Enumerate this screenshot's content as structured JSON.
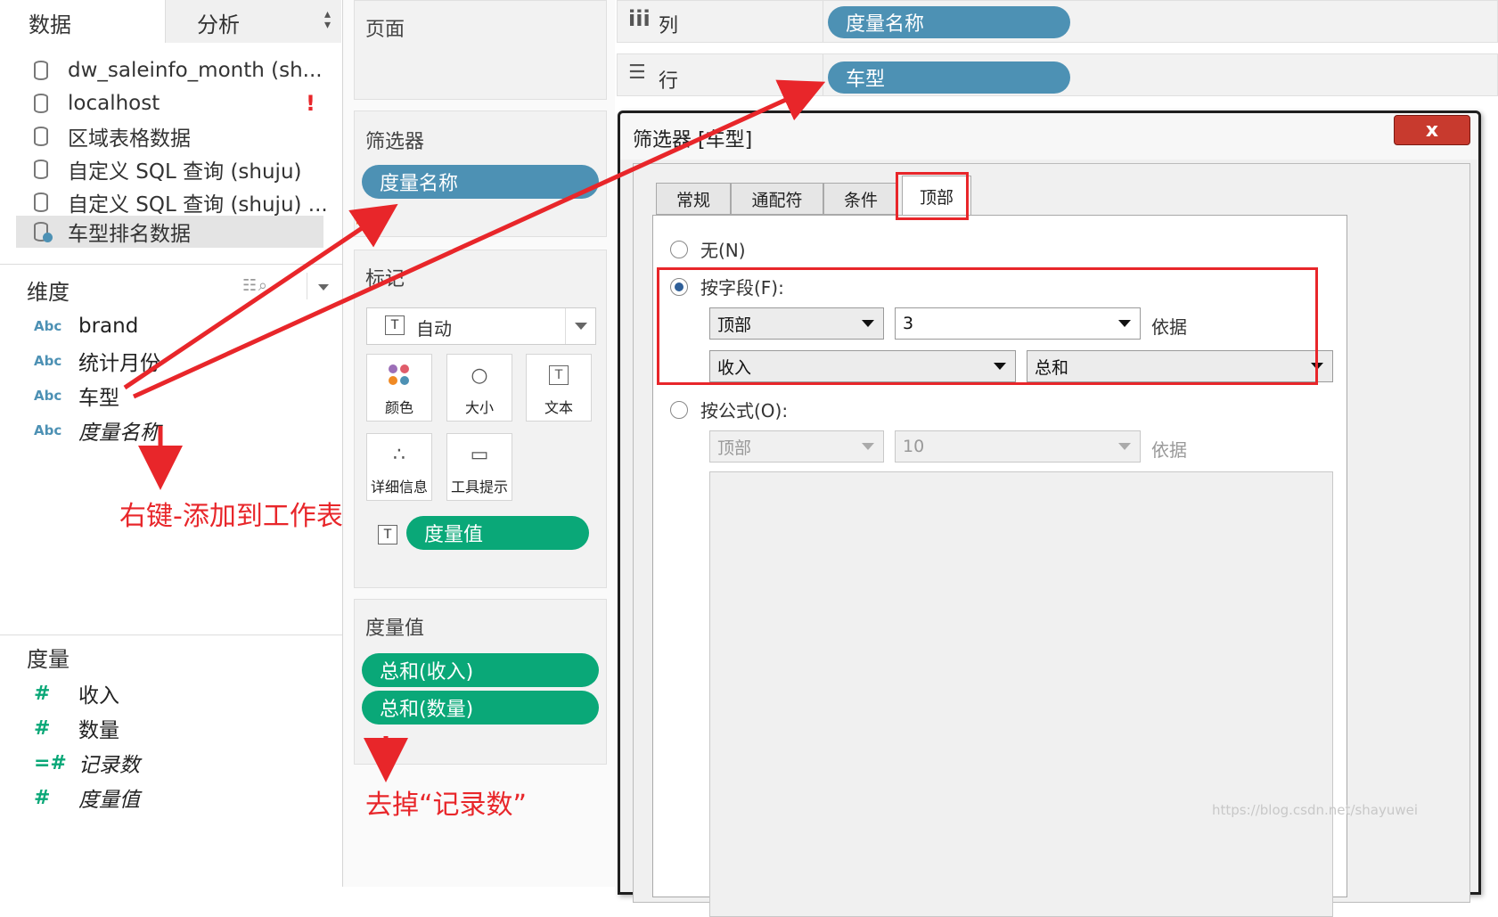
{
  "left_tabs": {
    "data": "数据",
    "analysis": "分析"
  },
  "data_sources": [
    {
      "name": "dw_saleinfo_month (sh...",
      "warning": ""
    },
    {
      "name": "localhost",
      "warning": "!"
    },
    {
      "name": "区域表格数据",
      "warning": ""
    },
    {
      "name": "自定义 SQL 查询 (shuju)",
      "warning": ""
    },
    {
      "name": "自定义 SQL 查询 (shuju) ...",
      "warning": ""
    },
    {
      "name": "车型排名数据",
      "warning": ""
    }
  ],
  "dimensions": {
    "title": "维度",
    "items": [
      {
        "type": "Abc",
        "name": "brand"
      },
      {
        "type": "Abc",
        "name": "统计月份"
      },
      {
        "type": "Abc",
        "name": "车型"
      },
      {
        "type": "Abc",
        "name": "度量名称"
      }
    ]
  },
  "measures": {
    "title": "度量",
    "items": [
      {
        "type": "#",
        "name": "收入"
      },
      {
        "type": "#",
        "name": "数量"
      },
      {
        "type": "=#",
        "name": "记录数"
      },
      {
        "type": "#",
        "name": "度量值"
      }
    ]
  },
  "pages": {
    "title": "页面"
  },
  "filters": {
    "title": "筛选器",
    "pill": "度量名称"
  },
  "marks": {
    "title": "标记",
    "type_value": "自动",
    "type_icon": "T",
    "buttons": [
      {
        "label": "颜色",
        "icon": "dots"
      },
      {
        "label": "大小",
        "icon": "○"
      },
      {
        "label": "文本",
        "icon": "T"
      },
      {
        "label": "详细信息",
        "icon": "∴"
      },
      {
        "label": "工具提示",
        "icon": "▭"
      }
    ],
    "text_pill": "度量值",
    "text_icon": "T"
  },
  "measure_values": {
    "title": "度量值",
    "pills": [
      "总和(收入)",
      "总和(数量)"
    ]
  },
  "shelves": {
    "columns": {
      "icon": "iii",
      "label": "列",
      "pill": "度量名称"
    },
    "rows": {
      "icon": "☰",
      "label": "行",
      "pill": "车型"
    }
  },
  "dialog": {
    "title": "筛选器 [车型]",
    "close": "x",
    "tabs": [
      "常规",
      "通配符",
      "条件",
      "顶部"
    ],
    "opt_none": "无(N)",
    "opt_field": "按字段(F):",
    "field_top": "顶部",
    "field_n": "3",
    "field_by": "依据",
    "field_measure": "收入",
    "field_agg": "总和",
    "opt_formula": "按公式(O):",
    "formula_top": "顶部",
    "formula_n": "10",
    "formula_by": "依据"
  },
  "annotations": {
    "right_click": "右键-添加到工作表",
    "remove_count": "去掉“记录数”"
  },
  "watermark": "https://blog.csdn.net/shayuwei",
  "colors": {
    "blue_pill": "#4d91b4",
    "green_pill": "#0aa878",
    "annotation_red": "#e8262a"
  }
}
